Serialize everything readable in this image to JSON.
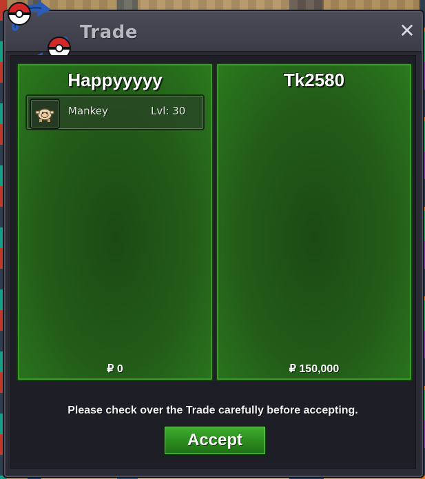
{
  "window": {
    "title": "Trade",
    "close_symbol": "✕"
  },
  "players": [
    {
      "name": "Happyyyyy",
      "money": "₽ 0",
      "items": [
        {
          "pokemon": "Mankey",
          "level": "Lvl: 30",
          "icon": "mankey-sprite-icon"
        }
      ]
    },
    {
      "name": "Tk2580",
      "money": "₽ 150,000",
      "items": []
    }
  ],
  "notice": "Please check over the Trade carefully before accepting.",
  "accept_label": "Accept",
  "colors": {
    "panel_green": "#235c18",
    "panel_border": "#3a9a28",
    "accept_green": "#2b8a1e",
    "window_bg": "#2a2b35",
    "titlebar_bg": "#44444f",
    "pokeball_red": "#d62828",
    "arrow_blue": "#2a5db8"
  }
}
